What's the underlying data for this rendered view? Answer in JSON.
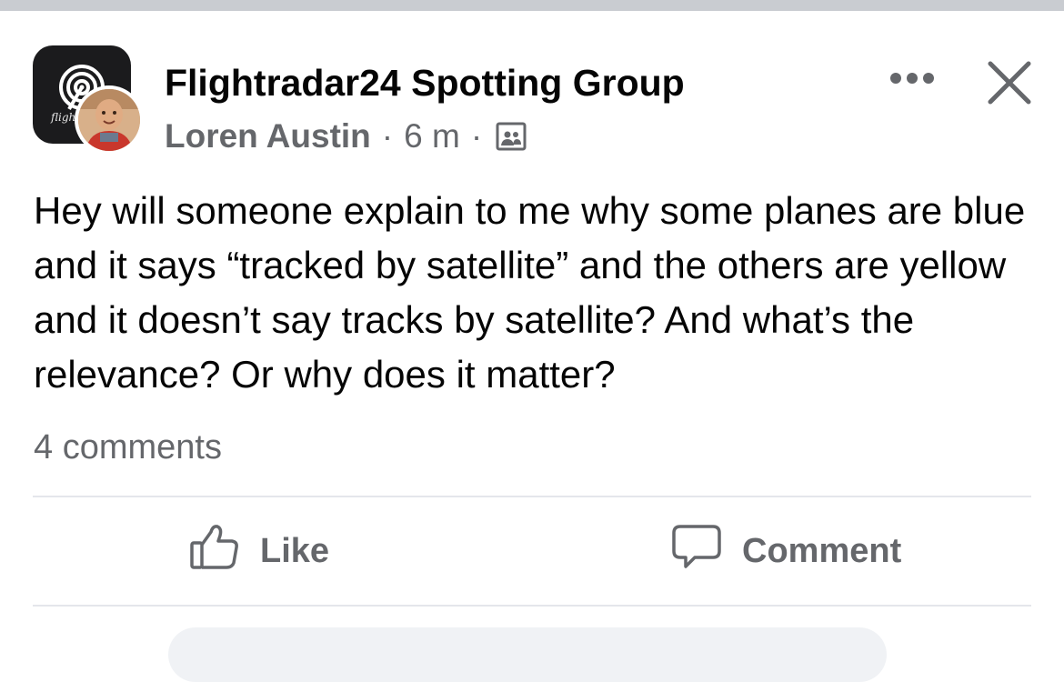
{
  "group": {
    "name": "Flightradar24 Spotting Group",
    "avatar_text": "fligh",
    "avatar_icon": "radar-icon"
  },
  "post": {
    "author": "Loren Austin",
    "time": "6 m",
    "separator": "·",
    "privacy_icon": "group-members-icon",
    "body": "Hey will someone explain to me why some planes are blue and it says “tracked by satellite” and the others are yellow and it doesn’t say tracks by satellite? And what’s the relevance? Or why does it matter?"
  },
  "stats": {
    "comments": "4 comments"
  },
  "actions": {
    "like_label": "Like",
    "comment_label": "Comment"
  },
  "icons": {
    "more": "more-options-icon",
    "close": "close-icon",
    "like": "thumbs-up-icon",
    "comment": "comment-bubble-icon"
  },
  "colors": {
    "text_primary": "#050505",
    "text_secondary": "#65676b",
    "divider": "#e4e6eb",
    "group_avatar_bg": "#1b1b1d"
  }
}
